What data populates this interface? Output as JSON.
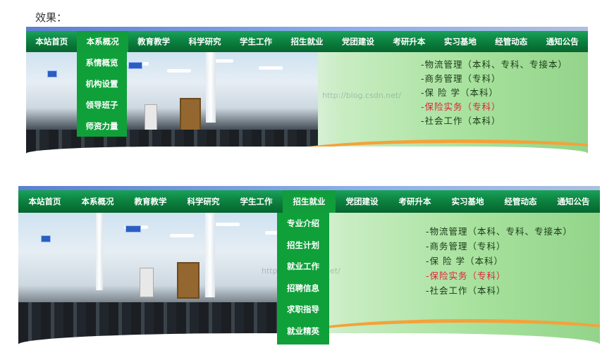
{
  "intro_label": "效果：",
  "nav_items": [
    "本站首页",
    "本系概况",
    "教育教学",
    "科学研究",
    "学生工作",
    "招生就业",
    "党团建设",
    "考研升本",
    "实习基地",
    "经管动态",
    "通知公告"
  ],
  "banner_a": {
    "active_index": 1,
    "dropdown_items": [
      "系情概览",
      "机构设置",
      "领导班子",
      "师资力量"
    ]
  },
  "banner_b": {
    "active_index": 5,
    "dropdown_items": [
      "专业介绍",
      "招生计划",
      "就业工作",
      "招聘信息",
      "求职指导",
      "就业精英"
    ]
  },
  "programs": [
    "-物流管理（本科、专科、专接本）",
    "-商务管理（专科）",
    "-保 险 学（本科）",
    "-保险实务（专科）",
    "-社会工作（本科）"
  ],
  "highlight_program_index": 3,
  "watermark": "http://blog.csdn.net/",
  "colors": {
    "nav_green": "#0b7d3c",
    "active_green": "#119d3b",
    "highlight": "#e0203a"
  }
}
